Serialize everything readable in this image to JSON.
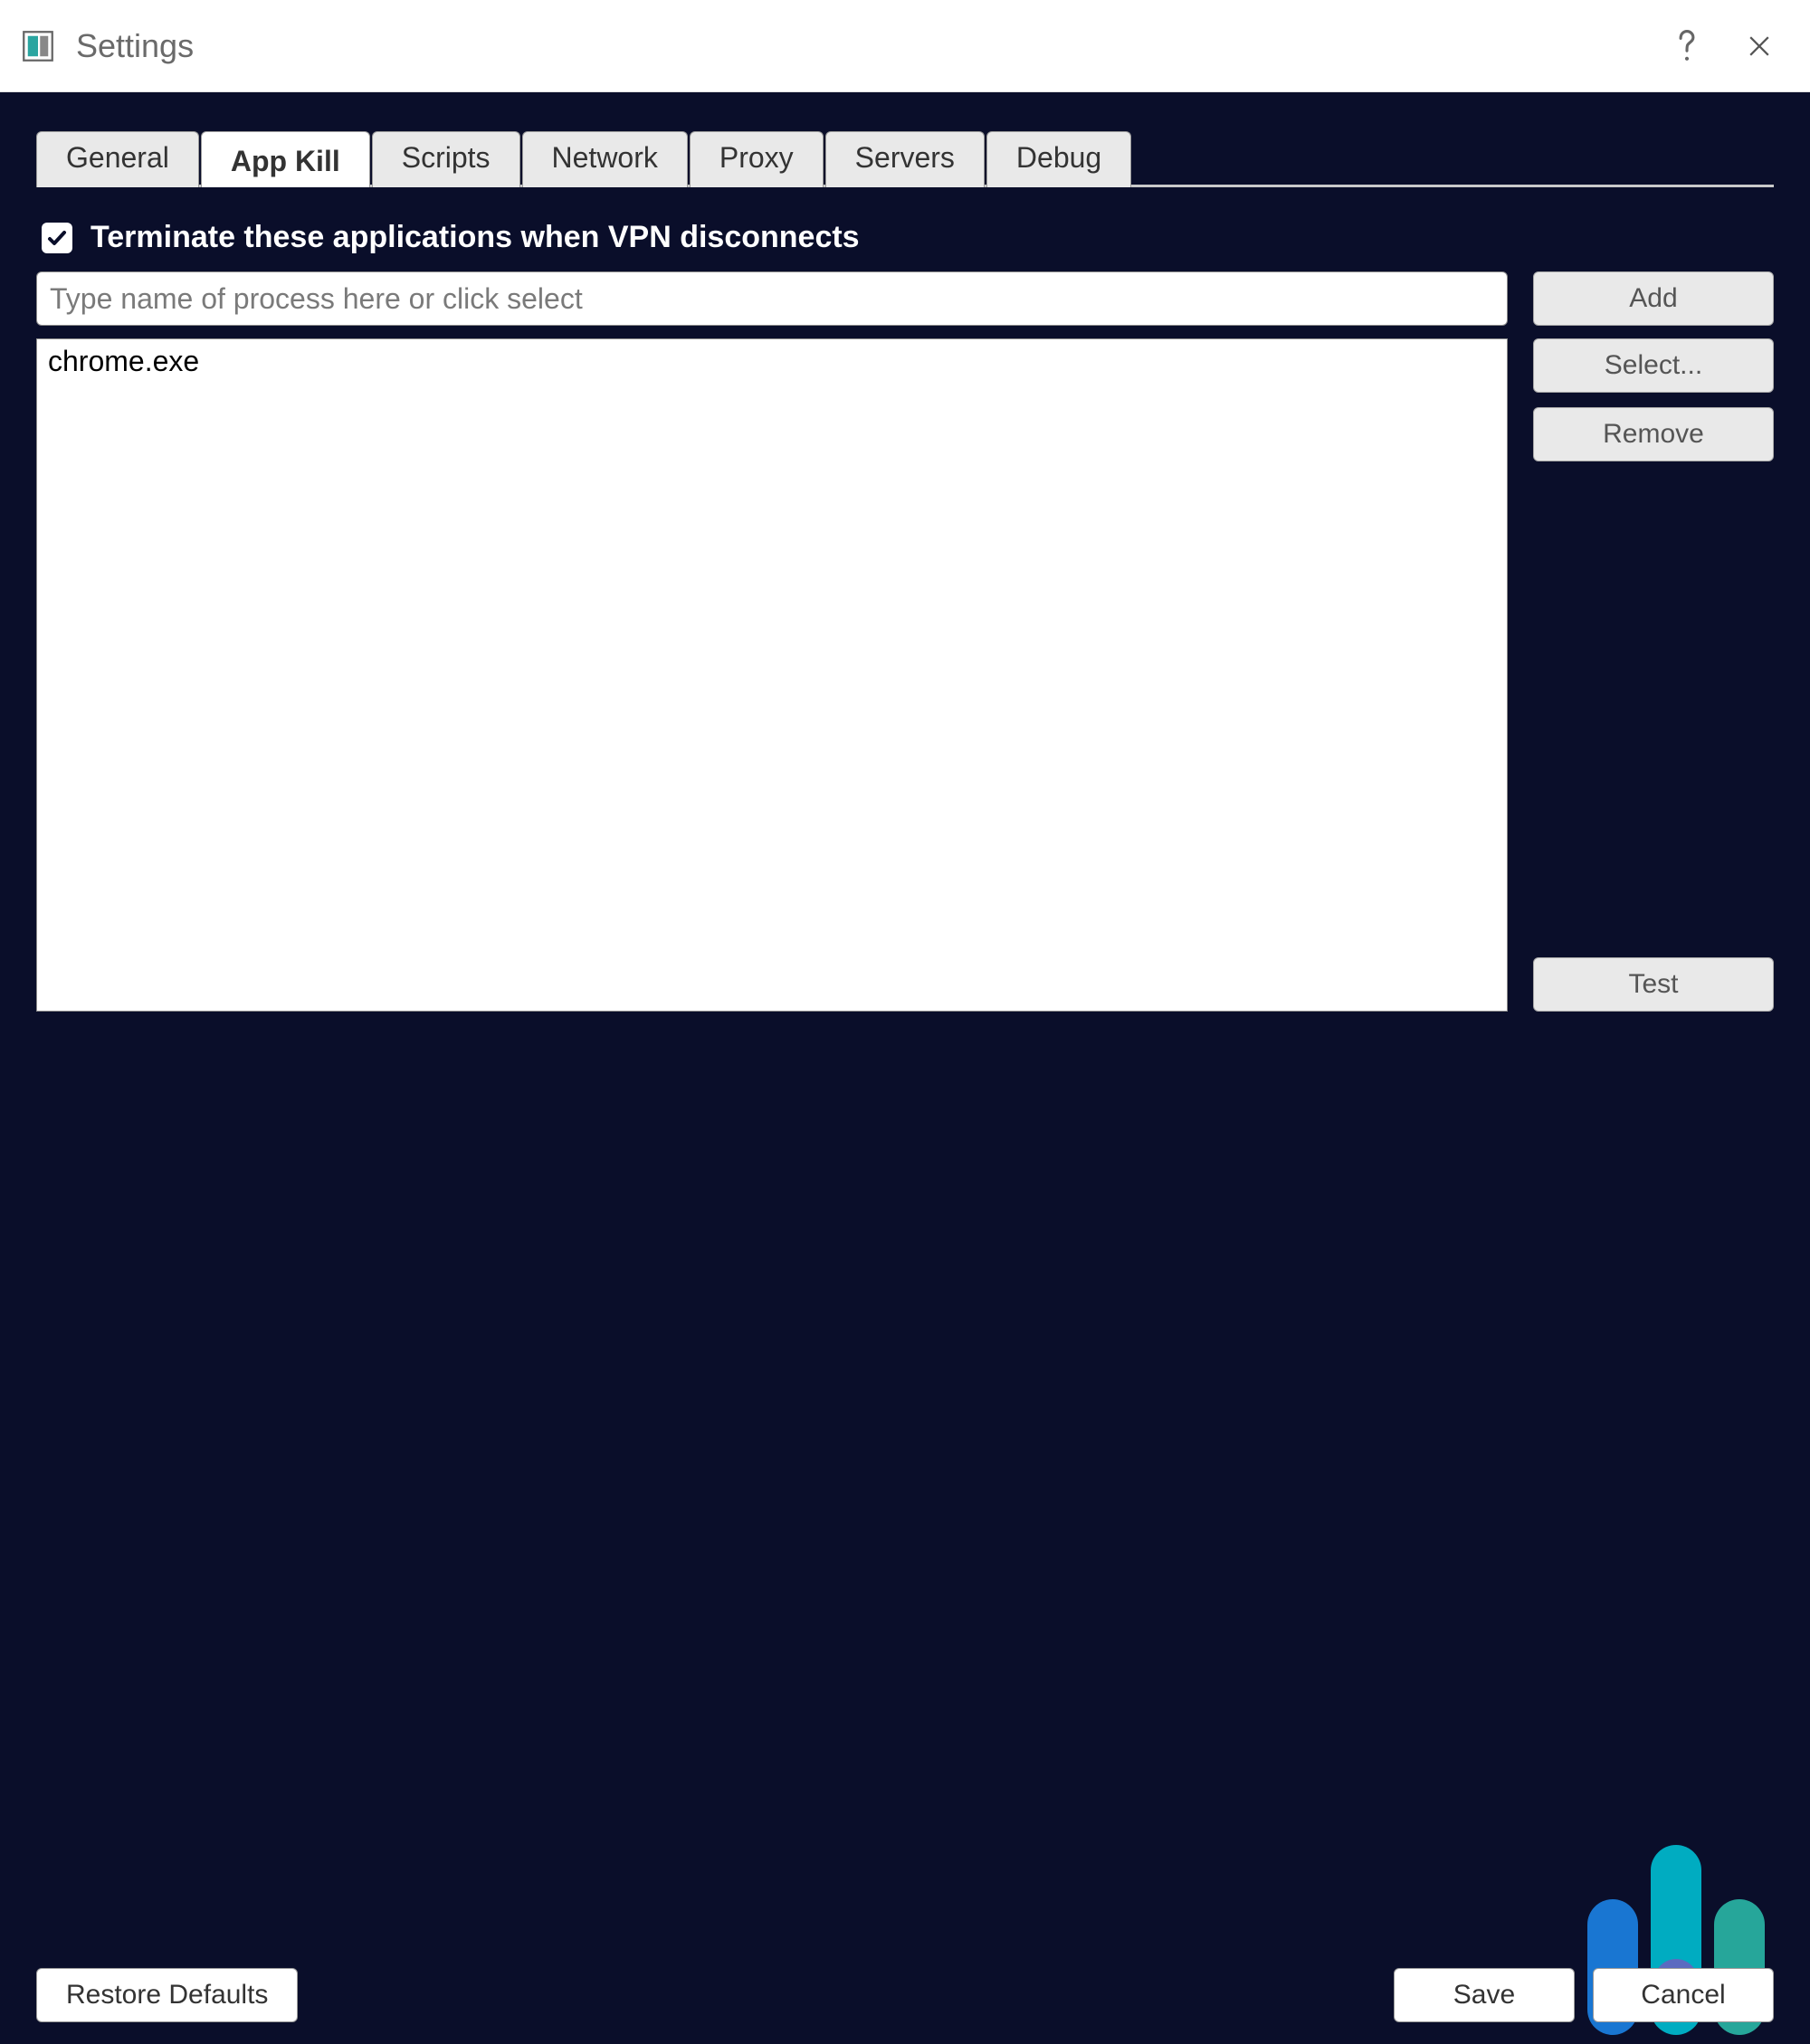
{
  "window": {
    "title": "Settings"
  },
  "tabs": {
    "items": [
      {
        "label": "General"
      },
      {
        "label": "App Kill"
      },
      {
        "label": "Scripts"
      },
      {
        "label": "Network"
      },
      {
        "label": "Proxy"
      },
      {
        "label": "Servers"
      },
      {
        "label": "Debug"
      }
    ],
    "active_index": 1
  },
  "appkill": {
    "checkbox_label": "Terminate these applications when VPN disconnects",
    "checked": true,
    "input_placeholder": "Type name of process here or click select",
    "input_value": "",
    "list": [
      "chrome.exe"
    ],
    "buttons": {
      "add": "Add",
      "select": "Select...",
      "remove": "Remove",
      "test": "Test"
    }
  },
  "footer": {
    "restore": "Restore Defaults",
    "save": "Save",
    "cancel": "Cancel"
  }
}
